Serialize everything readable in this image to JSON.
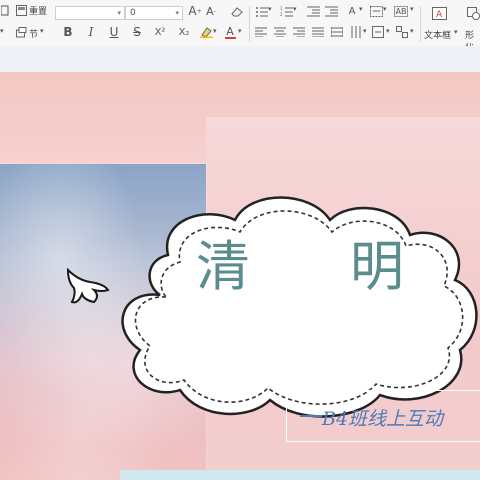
{
  "toolbar": {
    "redo_label": "重置",
    "section_label": "节",
    "font_name": "",
    "font_size": "0",
    "bold": "B",
    "italic": "I",
    "underline": "U",
    "strikethrough": "S",
    "superscript": "X²",
    "subscript": "X₂",
    "increase_font": "A",
    "decrease_font": "A",
    "clear_format": "",
    "font_color": "A",
    "textbox_label": "文本框",
    "shapes_label": "形状",
    "letter_a": "A",
    "letter_ab": "AB",
    "highlight": "",
    "spacing_icon": "A"
  },
  "slide": {
    "title_left": "清",
    "title_right": "明",
    "subtitle": "B4班线上互动",
    "colors": {
      "title": "#5b8c8e",
      "subtitle": "#4d7bb7",
      "background": "#f3c8c4"
    }
  }
}
